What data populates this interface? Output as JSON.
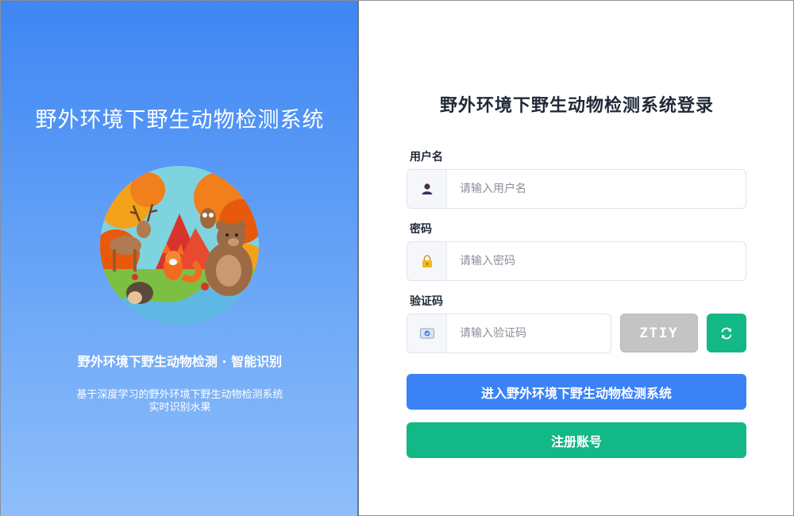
{
  "left": {
    "title": "野外环境下野生动物检测系统",
    "subtitle": "野外环境下野生动物检测  ·  智能识别",
    "desc_line1": "基于深度学习的野外环境下野生动物检测系统",
    "desc_line2": "实时识别水果"
  },
  "form": {
    "title": "野外环境下野生动物检测系统登录",
    "username": {
      "label": "用户名",
      "placeholder": "请输入用户名",
      "value": "",
      "icon": "user-icon"
    },
    "password": {
      "label": "密码",
      "placeholder": "请输入密码",
      "value": "",
      "icon": "lock-icon"
    },
    "captcha": {
      "label": "验证码",
      "placeholder": "请输入验证码",
      "value": "",
      "icon": "captcha-card-icon",
      "code": "ZTIY"
    },
    "refresh_icon": "refresh-icon",
    "login_label": "进入野外环境下野生动物检测系统",
    "register_label": "注册账号"
  },
  "colors": {
    "primary": "#3b82f6",
    "success": "#12b886",
    "left_gradient_top": "#3f86f4",
    "left_gradient_bottom": "#8fbefa",
    "captcha_bg": "#c4c4c4"
  }
}
